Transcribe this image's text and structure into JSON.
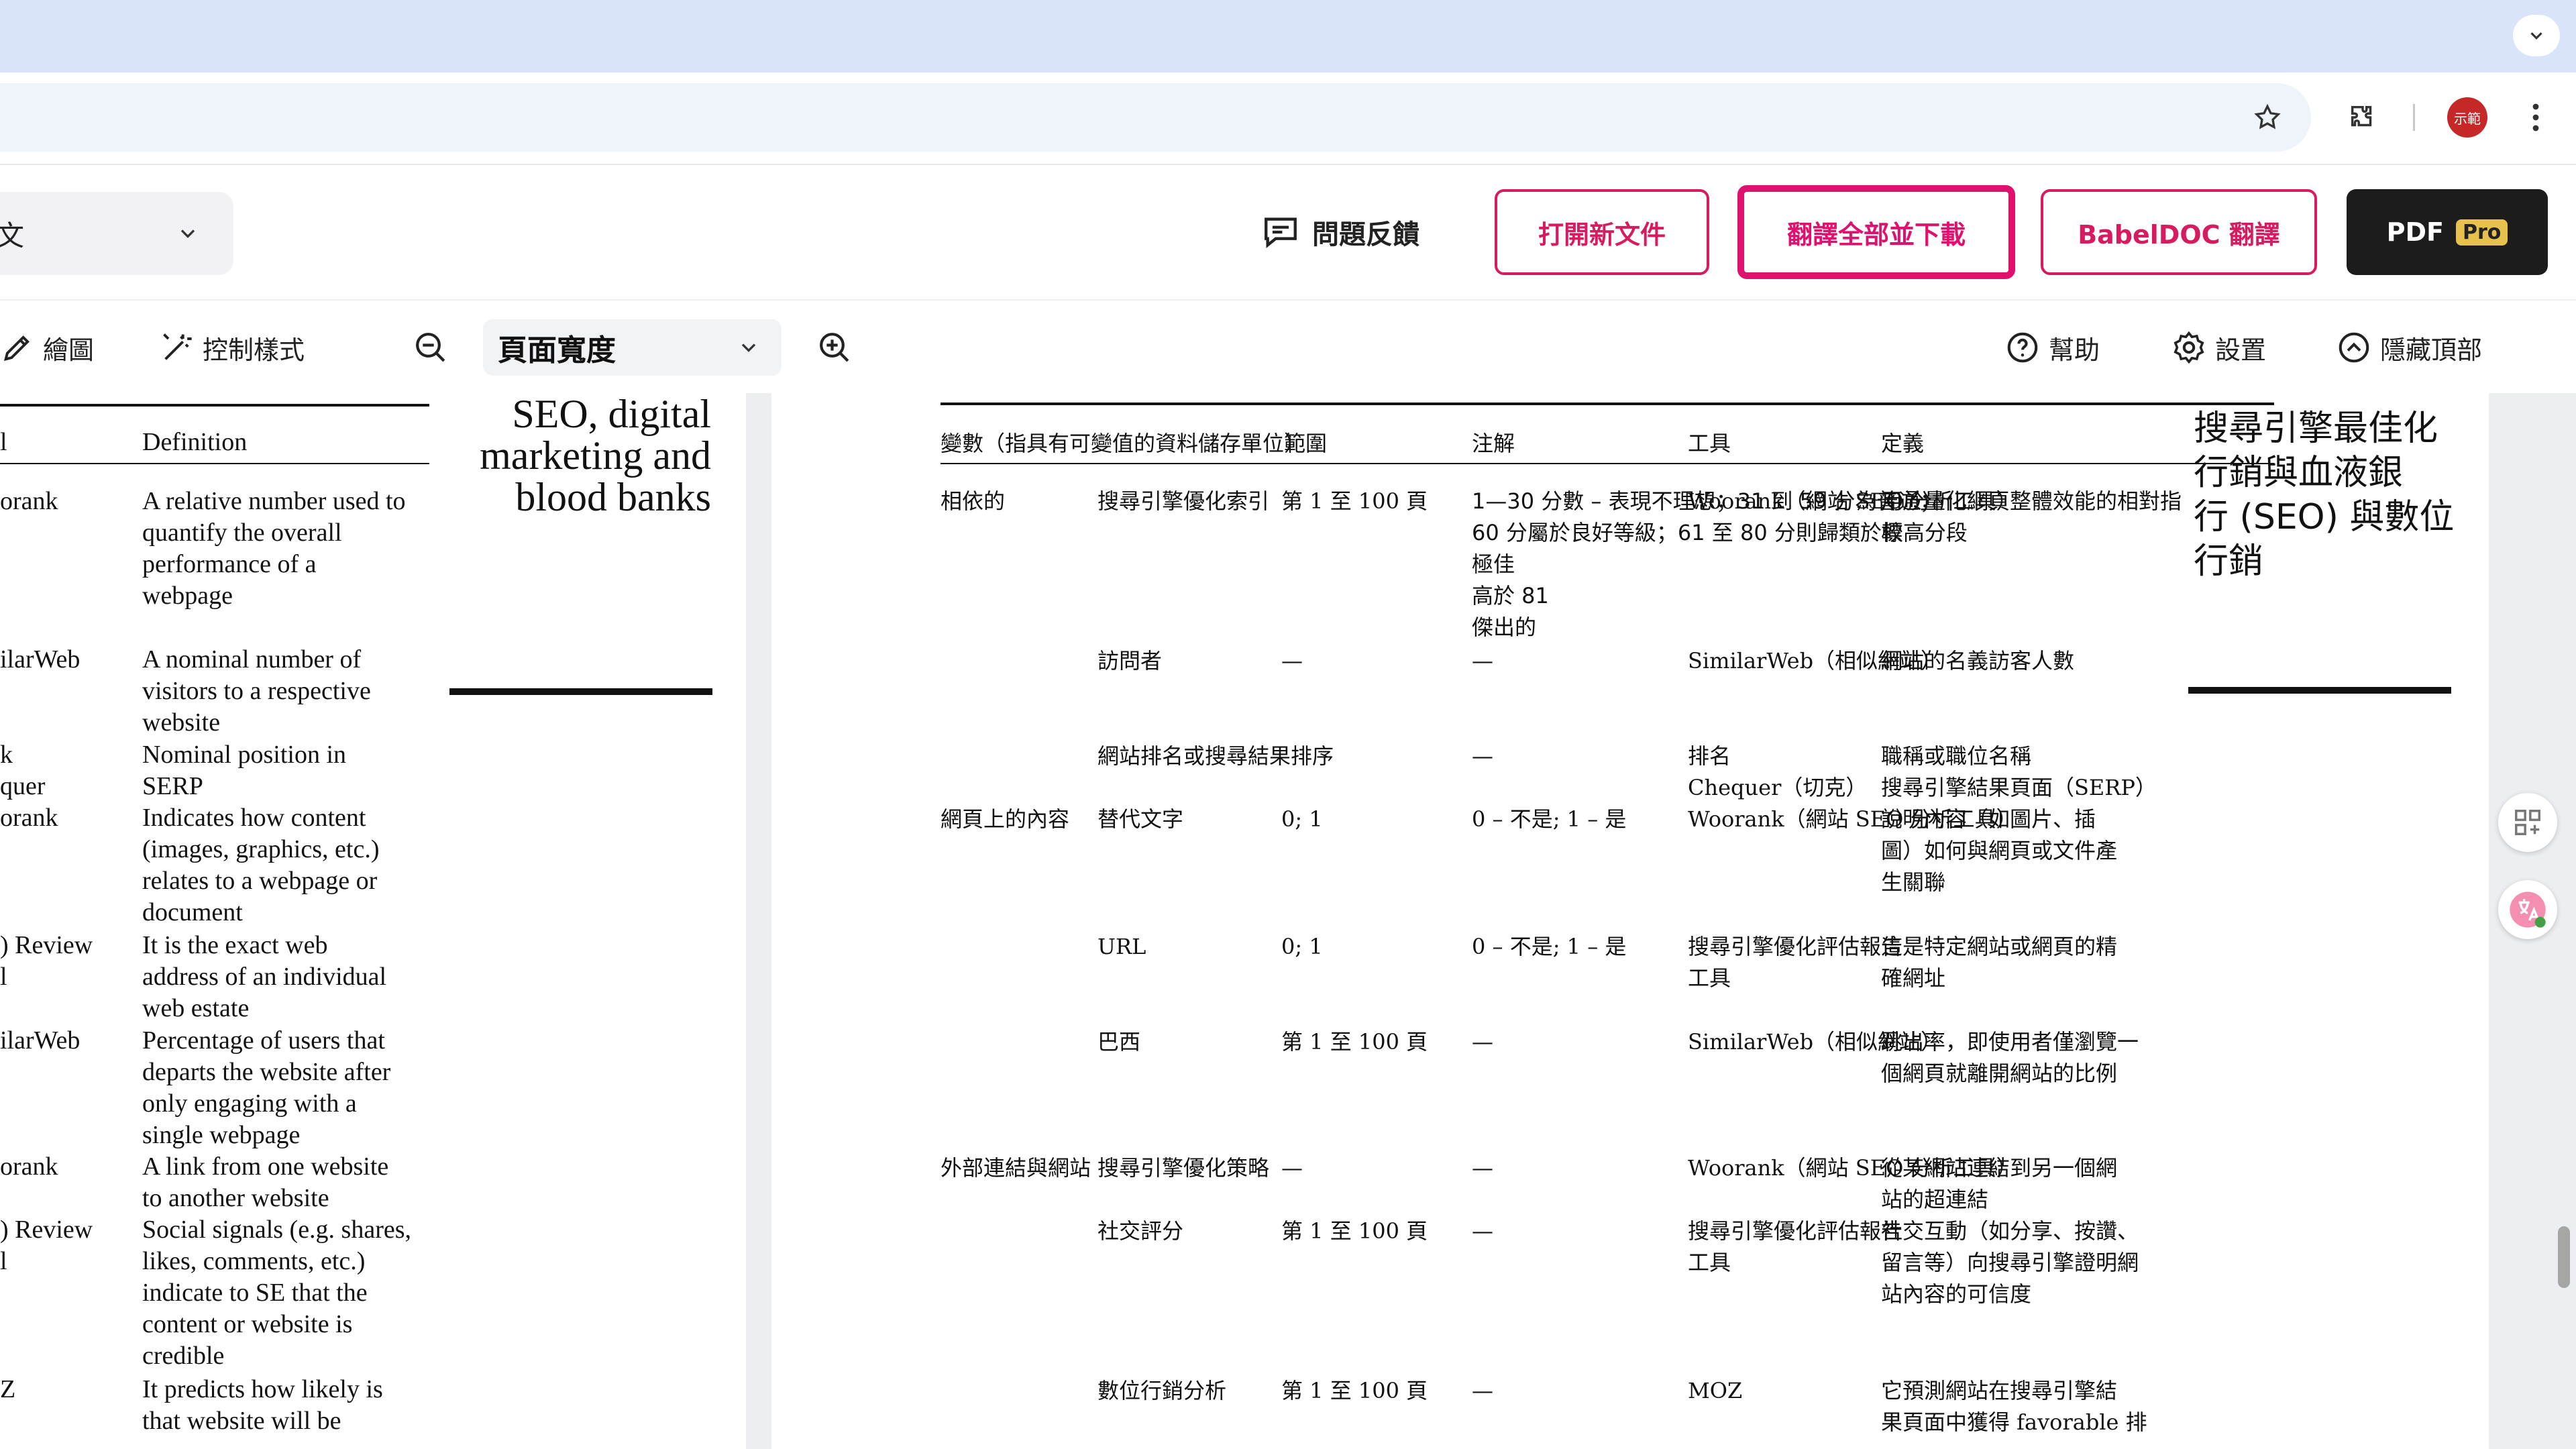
{
  "browser": {
    "profile_label": "示範"
  },
  "app_header": {
    "language_select_value": "文",
    "feedback_label": "問題反饋",
    "open_new_label": "打開新文件",
    "translate_all_label": "翻譯全部並下載",
    "babeldoc_label": "BabelDOC 翻譯",
    "pdf_label": "PDF",
    "pro_label": "Pro"
  },
  "viewer_toolbar": {
    "draw_label": "繪圖",
    "style_label": "控制樣式",
    "zoom_value": "頁面寬度",
    "help_label": "幫助",
    "settings_label": "設置",
    "hide_top_label": "隱藏頂部"
  },
  "left_page": {
    "header_col1": "l",
    "header_col2": "Definition",
    "sidebar_title": "SEO, digital\nmarketing and\nblood banks",
    "rows": [
      {
        "tool": "orank",
        "definition": "A relative number used to\nquantify the overall\nperformance of a\nwebpage"
      },
      {
        "tool": "ilarWeb",
        "definition": "A nominal number of\nvisitors to a respective\nwebsite"
      },
      {
        "tool": "k\nquer",
        "definition": "Nominal position in\nSERP"
      },
      {
        "tool": "orank",
        "definition": "Indicates how content\n(images, graphics, etc.)\nrelates to a webpage or\ndocument"
      },
      {
        "tool": ") Review\nl",
        "definition": "It is the exact web\naddress of an individual\nweb estate"
      },
      {
        "tool": "ilarWeb",
        "definition": "Percentage of users that\ndeparts the website after\nonly engaging with a\nsingle webpage"
      },
      {
        "tool": "orank",
        "definition": "A link from one website\nto another website"
      },
      {
        "tool": ") Review\nl",
        "definition": "Social signals (e.g. shares,\nlikes, comments, etc.)\nindicate to SE that the\ncontent or website is\ncredible"
      },
      {
        "tool": "Z",
        "definition": "It predicts how likely is\nthat website will be"
      }
    ]
  },
  "right_page": {
    "header_variable": "變數（指具有可變值的資料儲存單位）",
    "header_range": "範圍",
    "header_notes": "注解",
    "header_tool": "工具",
    "header_definition": "定義",
    "sidebar_title": "搜尋引擎最佳化\n行銷與血液銀\n行 (SEO) 與數位\n行銷",
    "rows": [
      {
        "category": "相依的",
        "variable": "搜尋引擎優化索引",
        "range": "第 1 至 100 頁",
        "notes": "1—30 分數 – 表現不理想；31 到 59 分為普通；\n60 分屬於良好等級；61 至 80 分則歸類於較高分段\n極佳\n高於 81\n傑出的",
        "tool": "Woorank（網站 SEO 分析工具）",
        "definition": "用於量化網頁整體效能的相對指\n標"
      },
      {
        "category": "",
        "variable": "訪問者",
        "range": "—",
        "notes": "—",
        "tool": "SimilarWeb（相似網站）",
        "definition": "網站的名義訪客人數"
      },
      {
        "category": "",
        "variable": "網站排名或搜尋結果排序",
        "range": "",
        "notes": "—",
        "tool": "排名\nChequer（切克）",
        "definition": "職稱或職位名稱\n搜尋引擎結果頁面（SERP）"
      },
      {
        "category": "網頁上的內容",
        "variable": "替代文字",
        "range": "0; 1",
        "notes": "0 – 不是; 1 – 是",
        "tool": "Woorank（網站 SEO 分析工具）",
        "definition": "說明內容（如圖片、插\n圖）如何與網頁或文件產\n生關聯"
      },
      {
        "category": "",
        "variable": "URL",
        "range": "0; 1",
        "notes": "0 – 不是; 1 – 是",
        "tool": "搜尋引擎優化評估報告\n工具",
        "definition": "這是特定網站或網頁的精\n確網址"
      },
      {
        "category": "",
        "variable": "巴西",
        "range": "第 1 至 100 頁",
        "notes": "—",
        "tool": "SimilarWeb（相似網站）",
        "definition": "跳出率，即使用者僅瀏覽一\n個網頁就離開網站的比例"
      },
      {
        "category": "外部連結與網站",
        "variable": "搜尋引擎優化策略",
        "range": "—",
        "notes": "—",
        "tool": "Woorank（網站 SEO 分析工具）",
        "definition": "從某網站連結到另一個網\n站的超連結"
      },
      {
        "category": "",
        "variable": "社交評分",
        "range": "第 1 至 100 頁",
        "notes": "—",
        "tool": "搜尋引擎優化評估報告\n工具",
        "definition": "社交互動（如分享、按讚、\n留言等）向搜尋引擎證明網\n站內容的可信度"
      },
      {
        "category": "",
        "variable": "數位行銷分析",
        "range": "第 1 至 100 頁",
        "notes": "—",
        "tool": "MOZ",
        "definition": "它預測網站在搜尋引擎結\n果頁面中獲得 favorable 排"
      }
    ]
  }
}
